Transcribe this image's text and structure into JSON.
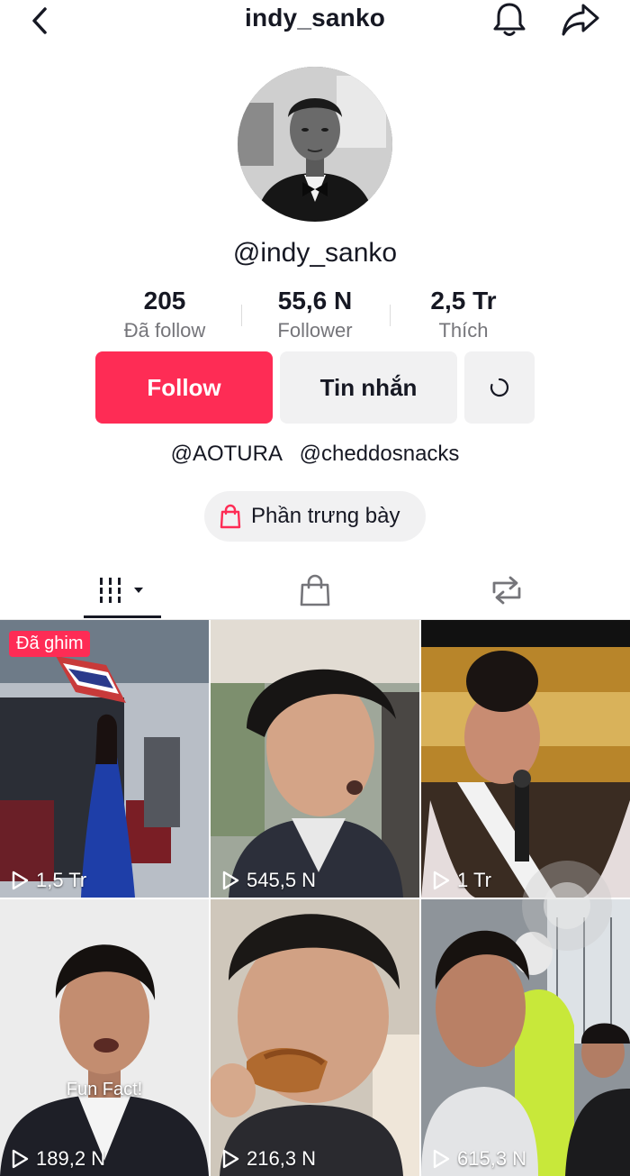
{
  "header": {
    "username": "indy_sanko"
  },
  "profile": {
    "handle": "@indy_sanko",
    "stats": [
      {
        "value": "205",
        "label": "Đã follow"
      },
      {
        "value": "55,6 N",
        "label": "Follower"
      },
      {
        "value": "2,5 Tr",
        "label": "Thích"
      }
    ],
    "follow_label": "Follow",
    "message_label": "Tin nhắn",
    "bio_links": [
      "@AOTURA",
      "@cheddosnacks"
    ],
    "showcase_label": "Phần trưng bày"
  },
  "colors": {
    "accent": "#fe2c55",
    "secondary_bg": "#f1f1f2",
    "text": "#161823",
    "muted": "#75757a"
  },
  "tabs": [
    {
      "icon": "videos-grid-icon",
      "active": true
    },
    {
      "icon": "shopping-bag-icon",
      "active": false
    },
    {
      "icon": "repost-icon",
      "active": false
    }
  ],
  "videos": [
    {
      "views": "1,5 Tr",
      "pinned_label": "Đã ghim"
    },
    {
      "views": "545,5 N"
    },
    {
      "views": "1 Tr"
    },
    {
      "views": "189,2 N",
      "caption": "Fun Fact!"
    },
    {
      "views": "216,3 N"
    },
    {
      "views": "615,3 N"
    }
  ]
}
